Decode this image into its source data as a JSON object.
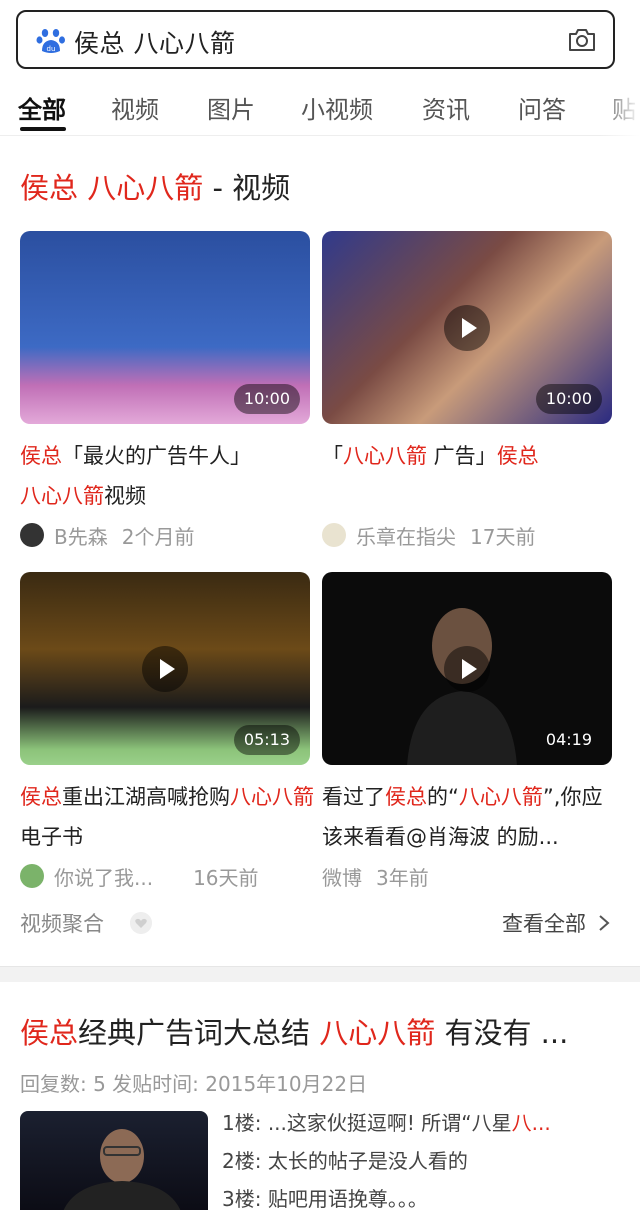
{
  "search": {
    "query": "侯总 八心八箭"
  },
  "tabs": [
    {
      "label": "全部"
    },
    {
      "label": "视频"
    },
    {
      "label": "图片"
    },
    {
      "label": "小视频"
    },
    {
      "label": "资讯"
    },
    {
      "label": "问答"
    },
    {
      "label": "贴"
    }
  ],
  "video_section": {
    "title_red1": "侯总",
    "title_red2": "八心八箭",
    "title_suffix": " - 视频",
    "cards": [
      {
        "duration": "10:00",
        "title_parts": [
          "侯总",
          "「最火的广告牛人」",
          "八心八箭",
          "视频"
        ],
        "author": "B先森",
        "time": "2个月前",
        "avatar_color": "#333333"
      },
      {
        "duration": "10:00",
        "title_parts": [
          "「",
          "八心八箭",
          " 广告」",
          "侯总"
        ],
        "author": "乐章在指尖",
        "time": "17天前",
        "avatar_color": "#e9e3d0"
      },
      {
        "duration": "05:13",
        "title_parts": [
          "侯总",
          "重出江湖高喊抢购",
          "八心八箭",
          "电子书"
        ],
        "author": "你说了我...",
        "time": "16天前",
        "avatar_color": "#7bb36a"
      },
      {
        "duration": "04:19",
        "title_parts": [
          "看过了",
          "侯总",
          "的“",
          "八心八箭",
          "”,你应该来看看@肖海波 的励..."
        ],
        "author": "微博",
        "time": "3年前",
        "avatar_color": ""
      }
    ],
    "aggregate_label": "视频聚合",
    "view_all": "查看全部"
  },
  "result2": {
    "title_parts": [
      "侯总",
      "经典广告词大总结 ",
      "八心八箭",
      " 有没有 ..."
    ],
    "meta": "回复数: 5   发贴时间: 2015年10月22日",
    "lines": [
      {
        "text": "1楼: ...这家伙挺逗啊! 所谓“八星",
        "red": "八..."
      },
      {
        "text": "2楼: 太长的帖子是没人看的",
        "red": ""
      },
      {
        "text": "3楼: 贴吧用语挽尊。。。",
        "red": ""
      }
    ]
  },
  "colors": {
    "highlight": "#e0271c",
    "text": "#222222",
    "muted": "#999999"
  }
}
